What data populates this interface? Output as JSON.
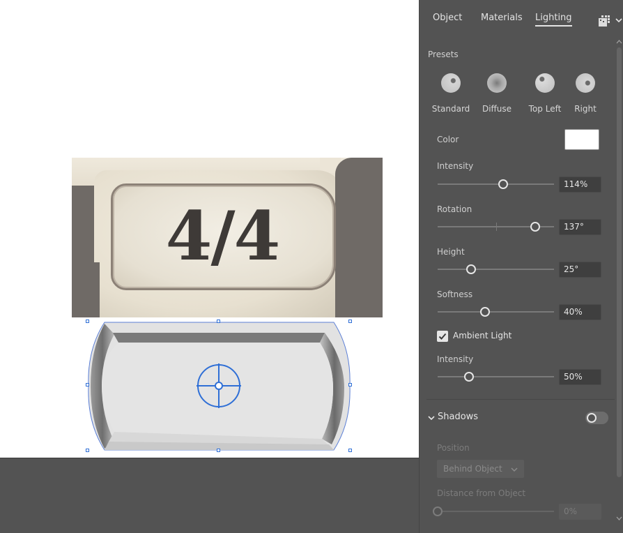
{
  "canvas": {
    "reference_photo_text": "4/4"
  },
  "panel": {
    "tabs": [
      {
        "label": "Object"
      },
      {
        "label": "Materials"
      },
      {
        "label": "Lighting",
        "active": true
      }
    ],
    "presets": {
      "heading": "Presets",
      "items": [
        {
          "label": "Standard"
        },
        {
          "label": "Diffuse"
        },
        {
          "label": "Top Left"
        },
        {
          "label": "Right"
        }
      ]
    },
    "color": {
      "label": "Color",
      "value_hex": "#ffffff"
    },
    "intensity": {
      "label": "Intensity",
      "value": "114%",
      "fraction": 0.56
    },
    "rotation": {
      "label": "Rotation",
      "value": "137°",
      "fraction": 0.84
    },
    "height": {
      "label": "Height",
      "value": "25°",
      "fraction": 0.29
    },
    "softness": {
      "label": "Softness",
      "value": "40%",
      "fraction": 0.41
    },
    "ambient_light": {
      "label": "Ambient Light",
      "checked": true
    },
    "ambient_intensity": {
      "label": "Intensity",
      "value": "50%",
      "fraction": 0.27
    },
    "shadows": {
      "label": "Shadows",
      "enabled": false,
      "position": {
        "label": "Position",
        "selected": "Behind Object"
      },
      "distance": {
        "label": "Distance from Object",
        "value": "0%",
        "fraction": 0.0
      }
    }
  },
  "colors": {
    "panel_bg": "#535353",
    "field_bg": "#3f3f3f",
    "selection_blue": "#2f6fd6",
    "text": "#d6d6d6"
  },
  "icons": {
    "panel_menu": "panel-menu-icon",
    "panel_chevron": "chevron-down-icon",
    "checkbox": "checkmark-icon",
    "shadows_chevron": "chevron-down-icon",
    "widget": "3d-rotate-widget-icon"
  }
}
